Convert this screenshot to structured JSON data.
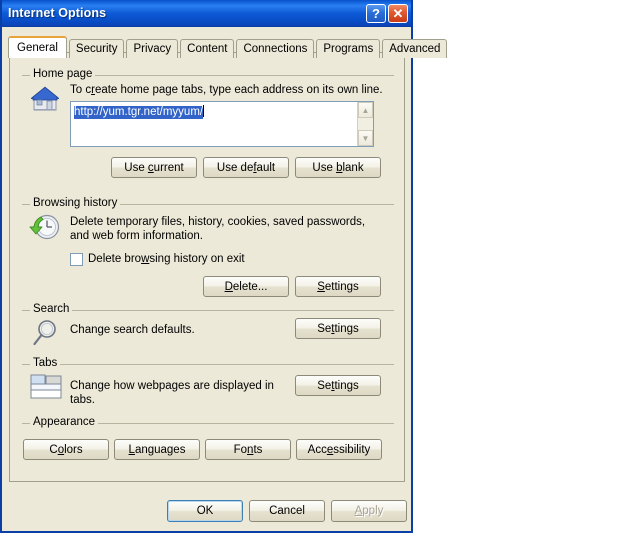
{
  "window": {
    "title": "Internet Options",
    "help_button": "?",
    "close_button": "✕",
    "titlebar_color": "#0a50c8",
    "dialog_face_color": "#ece9d8"
  },
  "tabs": [
    {
      "label": "General",
      "selected": true
    },
    {
      "label": "Security",
      "selected": false
    },
    {
      "label": "Privacy",
      "selected": false
    },
    {
      "label": "Content",
      "selected": false
    },
    {
      "label": "Connections",
      "selected": false
    },
    {
      "label": "Programs",
      "selected": false
    },
    {
      "label": "Advanced",
      "selected": false
    }
  ],
  "home_page": {
    "group_label": "Home page",
    "icon": "house-icon",
    "description_pre": "To c",
    "description_accel": "r",
    "description_post": "eate home page tabs, type each address on its own line.",
    "url_value": "http://yum.tgr.net/myyum/",
    "url_selected": true,
    "scroll_up": "▲",
    "scroll_down": "▼",
    "buttons": [
      {
        "pre": "Use ",
        "accel": "c",
        "post": "urrent",
        "name": "use-current-button"
      },
      {
        "pre": "Use de",
        "accel": "f",
        "post": "ault",
        "name": "use-default-button"
      },
      {
        "pre": "Use ",
        "accel": "b",
        "post": "lank",
        "name": "use-blank-button"
      }
    ]
  },
  "browsing_history": {
    "group_label": "Browsing history",
    "icon": "clock-refresh-icon",
    "description_line1": "Delete temporary files, history, cookies, saved passwords,",
    "description_line2": "and web form information.",
    "checkbox": {
      "pre": "Delete bro",
      "accel": "w",
      "post": "sing history on exit",
      "checked": false
    },
    "buttons": [
      {
        "pre": "",
        "accel": "D",
        "post": "elete...",
        "name": "delete-button"
      },
      {
        "pre": "",
        "accel": "S",
        "post": "ettings",
        "name": "history-settings-button"
      }
    ]
  },
  "search": {
    "group_label": "Search",
    "icon": "magnifier-icon",
    "description": "Change search defaults.",
    "button": {
      "pre": "Se",
      "accel": "t",
      "post": "tings",
      "name": "search-settings-button"
    }
  },
  "tabs_section": {
    "group_label": "Tabs",
    "icon": "browser-tabs-icon",
    "description_line1": "Change how webpages are displayed in",
    "description_line2": "tabs.",
    "button": {
      "pre": "Se",
      "accel": "t",
      "post": "tings",
      "name": "tabs-settings-button"
    }
  },
  "appearance": {
    "group_label": "Appearance",
    "buttons": [
      {
        "pre": "C",
        "accel": "o",
        "post": "lors",
        "name": "colors-button"
      },
      {
        "pre": "",
        "accel": "L",
        "post": "anguages",
        "name": "languages-button"
      },
      {
        "pre": "Fo",
        "accel": "n",
        "post": "ts",
        "name": "fonts-button"
      },
      {
        "pre": "Acc",
        "accel": "e",
        "post": "ssibility",
        "name": "accessibility-button"
      }
    ]
  },
  "footer": {
    "ok": "OK",
    "cancel": "Cancel",
    "apply_pre": "",
    "apply_accel": "A",
    "apply_post": "pply",
    "apply_disabled": true
  }
}
